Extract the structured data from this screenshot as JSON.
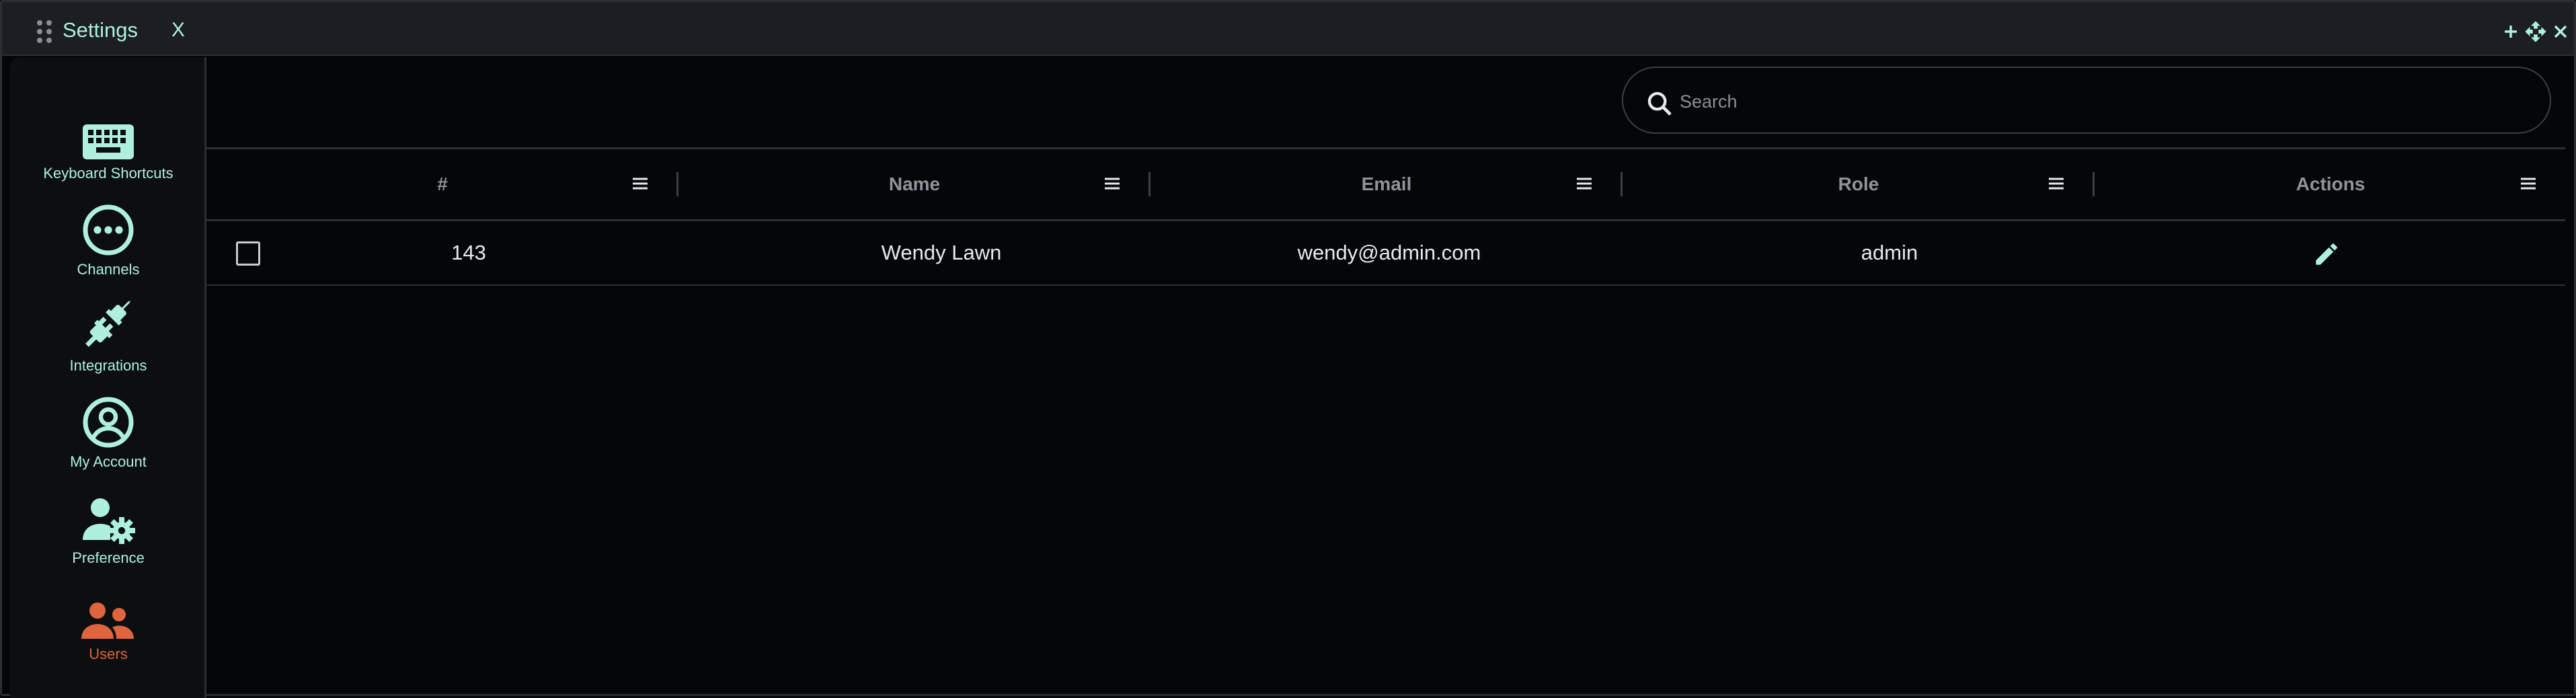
{
  "window": {
    "title": "Settings",
    "close_label": "X",
    "actions": [
      "plus-icon",
      "move-icon",
      "close-icon"
    ]
  },
  "sidebar": {
    "items": [
      {
        "label": "Keyboard Shortcuts",
        "icon": "keyboard-icon",
        "active": false
      },
      {
        "label": "Channels",
        "icon": "more-dots-circle-icon",
        "active": false
      },
      {
        "label": "Integrations",
        "icon": "plug-icon",
        "active": false
      },
      {
        "label": "My Account",
        "icon": "account-circle-icon",
        "active": false
      },
      {
        "label": "Preference",
        "icon": "user-settings-icon",
        "active": false
      },
      {
        "label": "Users",
        "icon": "users-icon",
        "active": true
      }
    ]
  },
  "search": {
    "placeholder": "Search",
    "value": ""
  },
  "table": {
    "columns": [
      "#",
      "Name",
      "Email",
      "Role",
      "Actions"
    ],
    "rows": [
      {
        "id": "143",
        "name": "Wendy Lawn",
        "email": "wendy@admin.com",
        "role": "admin",
        "checked": false
      }
    ]
  },
  "colors": {
    "accent": "#aef0dc",
    "active": "#e0643d",
    "background": "#050607",
    "titlebar": "#1b1e22"
  }
}
